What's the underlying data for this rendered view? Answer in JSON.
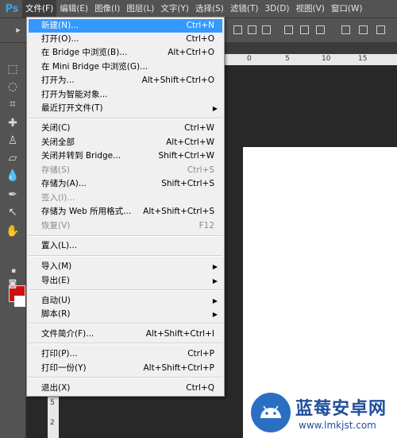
{
  "app": {
    "logo": "Ps"
  },
  "menubar": {
    "items": [
      "文件(F)",
      "编辑(E)",
      "图像(I)",
      "图层(L)",
      "文字(Y)",
      "选择(S)",
      "滤镜(T)",
      "3D(D)",
      "视图(V)",
      "窗口(W)"
    ]
  },
  "ruler": {
    "top_marks": [
      "0",
      "5",
      "10",
      "15"
    ],
    "left_marks": [
      "1",
      "5",
      "2"
    ]
  },
  "file_menu": {
    "items": [
      {
        "label": "新建(N)...",
        "shortcut": "Ctrl+N",
        "highlighted": true
      },
      {
        "label": "打开(O)...",
        "shortcut": "Ctrl+O"
      },
      {
        "label": "在 Bridge 中浏览(B)...",
        "shortcut": "Alt+Ctrl+O"
      },
      {
        "label": "在 Mini Bridge 中浏览(G)...",
        "shortcut": ""
      },
      {
        "label": "打开为...",
        "shortcut": "Alt+Shift+Ctrl+O"
      },
      {
        "label": "打开为智能对象...",
        "shortcut": ""
      },
      {
        "label": "最近打开文件(T)",
        "shortcut": "",
        "submenu": true
      },
      {
        "label": "关闭(C)",
        "shortcut": "Ctrl+W"
      },
      {
        "label": "关闭全部",
        "shortcut": "Alt+Ctrl+W"
      },
      {
        "label": "关闭并转到 Bridge...",
        "shortcut": "Shift+Ctrl+W"
      },
      {
        "label": "存储(S)",
        "shortcut": "Ctrl+S",
        "disabled": true
      },
      {
        "label": "存储为(A)...",
        "shortcut": "Shift+Ctrl+S"
      },
      {
        "label": "签入(I)...",
        "shortcut": "",
        "disabled": true
      },
      {
        "label": "存储为 Web 所用格式...",
        "shortcut": "Alt+Shift+Ctrl+S"
      },
      {
        "label": "恢复(V)",
        "shortcut": "F12",
        "disabled": true
      },
      {
        "label": "置入(L)...",
        "shortcut": ""
      },
      {
        "label": "导入(M)",
        "shortcut": "",
        "submenu": true
      },
      {
        "label": "导出(E)",
        "shortcut": "",
        "submenu": true
      },
      {
        "label": "自动(U)",
        "shortcut": "",
        "submenu": true
      },
      {
        "label": "脚本(R)",
        "shortcut": "",
        "submenu": true
      },
      {
        "label": "文件简介(F)...",
        "shortcut": "Alt+Shift+Ctrl+I"
      },
      {
        "label": "打印(P)...",
        "shortcut": "Ctrl+P"
      },
      {
        "label": "打印一份(Y)",
        "shortcut": "Alt+Shift+Ctrl+P"
      },
      {
        "label": "退出(X)",
        "shortcut": "Ctrl+Q"
      }
    ]
  },
  "colors": {
    "foreground": "#d01010",
    "background": "#ffffff",
    "highlight": "#3399ff"
  },
  "watermark": {
    "title": "蓝莓安卓网",
    "url": "www.lmkjst.com"
  }
}
